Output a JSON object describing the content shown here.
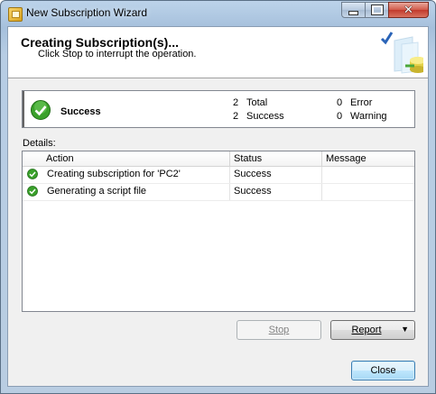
{
  "window": {
    "title": "New Subscription Wizard"
  },
  "header": {
    "title": "Creating Subscription(s)...",
    "subtitle": "Click Stop to interrupt the operation."
  },
  "summary": {
    "status": "Success",
    "total_count": "2",
    "total_label": "Total",
    "success_count": "2",
    "success_label": "Success",
    "error_count": "0",
    "error_label": "Error",
    "warning_count": "0",
    "warning_label": "Warning"
  },
  "details": {
    "label": "Details:",
    "columns": [
      "Action",
      "Status",
      "Message"
    ],
    "rows": [
      {
        "icon": "success-check-icon",
        "action": "Creating subscription for 'PC2'",
        "status": "Success",
        "message": ""
      },
      {
        "icon": "success-check-icon",
        "action": "Generating a script file",
        "status": "Success",
        "message": ""
      }
    ]
  },
  "buttons": {
    "stop": "Stop",
    "report": "Report",
    "close": "Close"
  },
  "colors": {
    "success_green": "#3aa12b",
    "title_bar": "#b9d1ea",
    "primary_button_border": "#3c7fb1"
  }
}
